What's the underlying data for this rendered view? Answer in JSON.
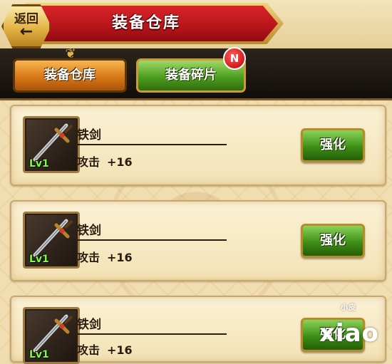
{
  "header": {
    "back_label": "返回",
    "back_arrow": "←",
    "title": "装备仓库"
  },
  "tabs": [
    {
      "label": "装备仓库",
      "active": true
    },
    {
      "label": "装备碎片",
      "active": false,
      "badge": "N"
    }
  ],
  "items": [
    {
      "name": "铁剑",
      "level": "Lv1",
      "stat_label": "攻击",
      "stat_value": "+16",
      "action": "强化"
    },
    {
      "name": "铁剑",
      "level": "Lv1",
      "stat_label": "攻击",
      "stat_value": "+16",
      "action": "强化"
    },
    {
      "name": "铁剑",
      "level": "Lv1",
      "stat_label": "攻击",
      "stat_value": "+16",
      "action": "强化"
    }
  ],
  "watermark": {
    "main": "xiao",
    "small": "小皮"
  },
  "colors": {
    "banner_red": "#c41a20",
    "tab_orange": "#d97816",
    "tab_green": "#4e9e1f",
    "button_green": "#3f8f16",
    "level_green": "#7cff3a",
    "parchment": "#f0ddb0"
  }
}
